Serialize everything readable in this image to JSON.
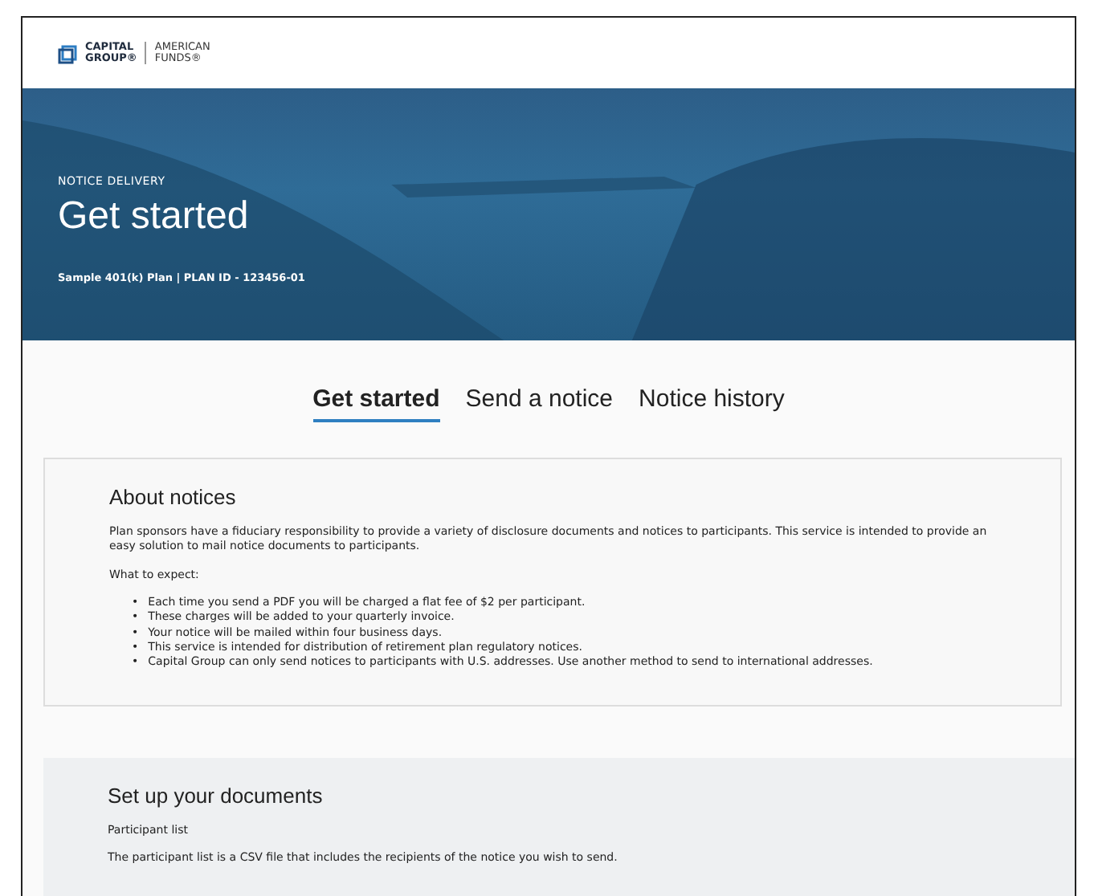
{
  "logo": {
    "brand": "CAPITAL",
    "brand_line2": "GROUP®",
    "sub": "AMERICAN",
    "sub_line2": "FUNDS®"
  },
  "hero": {
    "eyebrow": "NOTICE DELIVERY",
    "title": "Get started",
    "plan": "Sample 401(k) Plan | PLAN ID - 123456-01"
  },
  "tabs": [
    {
      "label": "Get started",
      "selected": true
    },
    {
      "label": "Send a notice",
      "selected": false
    },
    {
      "label": "Notice history",
      "selected": false
    }
  ],
  "about": {
    "title": "About notices",
    "intro": "Plan sponsors have a fiduciary responsibility to provide a variety of disclosure documents and notices to participants. This service is intended to provide an easy solution to mail notice documents to participants.",
    "expect_label": "What to expect:",
    "marker": "•",
    "bullets": [
      "Each time you send a PDF you will be charged a flat fee of $2 per participant.",
      "These charges will be added to your quarterly invoice.",
      "Your notice will be mailed within four business days.",
      "This service is intended for distribution of retirement plan regulatory notices.",
      "Capital Group can only send notices to participants with U.S. addresses. Use another method to send to international addresses."
    ]
  },
  "setup": {
    "title": "Set up your documents",
    "subtitle": "Participant list",
    "text": "The participant list is a CSV file that includes the recipients of the notice you wish to send."
  }
}
